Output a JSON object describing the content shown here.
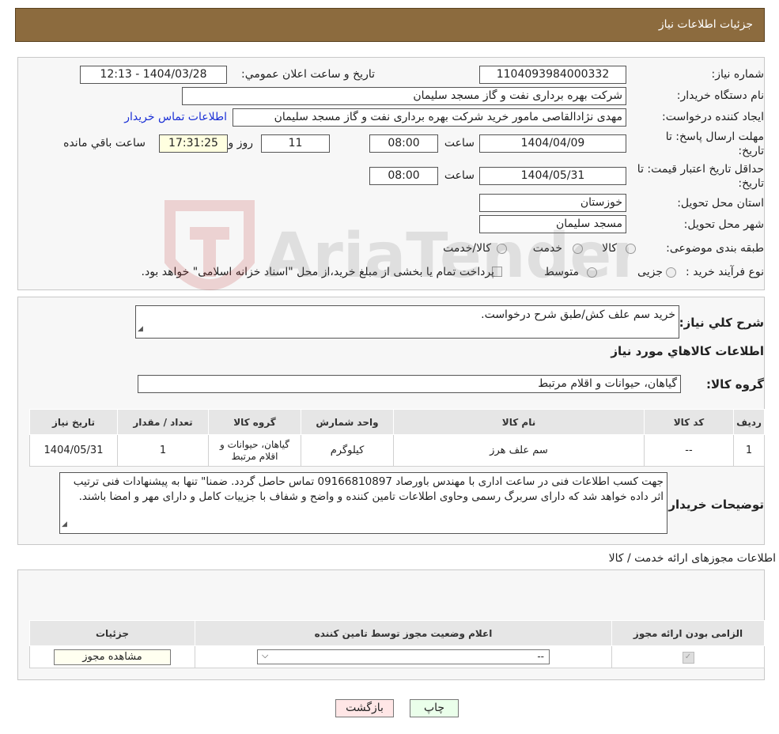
{
  "header": {
    "title": "جزئیات اطلاعات نیاز"
  },
  "fields": {
    "need_number_label": "شماره نیاز:",
    "need_number": "1104093984000332",
    "announce_label": "تاريخ و ساعت اعلان عمومي:",
    "announce_value": "1404/03/28 - 12:13",
    "buyer_org_label": "نام دستگاه خريدار:",
    "buyer_org": "شرکت بهره برداری نفت و گاز مسجد سلیمان",
    "creator_label": "ايجاد کننده درخواست:",
    "creator": "مهدی نژادالقاصی مامور خرید شرکت بهره برداری نفت و گاز مسجد سلیمان",
    "buyer_contact_link": "اطلاعات تماس خريدار",
    "reply_deadline_label_1": "مهلت ارسال پاسخ: تا",
    "reply_deadline_label_2": "تاريخ:",
    "reply_date": "1404/04/09",
    "time_label": "ساعت",
    "reply_time": "08:00",
    "days_value": "11",
    "days_label": "روز و",
    "remaining_time": "17:31:25",
    "remaining_label": "ساعت باقي مانده",
    "price_validity_label_1": "حداقل تاريخ اعتبار قيمت: تا",
    "price_validity_label_2": "تاريخ:",
    "validity_date": "1404/05/31",
    "validity_time": "08:00",
    "province_label": "استان محل تحويل:",
    "province": "خوزستان",
    "city_label": "شهر محل تحويل:",
    "city": "مسجد سلیمان",
    "category_label": "طبقه بندی موضوعی:",
    "category_options": [
      "کالا",
      "خدمت",
      "کالا/خدمت"
    ],
    "process_label": "نوع فرآيند خريد :",
    "process_options": [
      "جزیی",
      "متوسط"
    ],
    "process_note": "پرداخت تمام يا بخشی از مبلغ خريد،از محل \"اسناد خزانه اسلامی\" خواهد بود."
  },
  "summary": {
    "desc_label": "شرح كلي نياز:",
    "desc_value": "خرید سم علف کش/طبق شرح درخواست.",
    "goods_info_title": "اطلاعات كالاهاي مورد نياز",
    "goods_group_label": "گروه كالا:",
    "goods_group_value": "گیاهان، حیوانات و اقلام مرتبط"
  },
  "goods_table": {
    "headers": [
      "رديف",
      "كد كالا",
      "نام كالا",
      "واحد شمارش",
      "گروه كالا",
      "تعداد / مقدار",
      "تاريخ نياز"
    ],
    "rows": [
      [
        "1",
        "--",
        "سم علف هرز",
        "کیلوگرم",
        "گیاهان، حیوانات و اقلام مرتبط",
        "1",
        "1404/05/31"
      ]
    ]
  },
  "buyer_notes": {
    "label": "توضيحات خريدار:",
    "value": "جهت کسب اطلاعات فنی در ساعت اداری با مهندس باورصاد 09166810897 تماس حاصل گردد. ضمنا\" تنها به پیشنهادات فنی ترتیب اثر داده خواهد شد که دارای سربرگ رسمی وحاوی اطلاعات تامین کننده و واضح و شفاف با جزییات کامل و دارای مهر و امضا باشند."
  },
  "permits": {
    "title": "اطلاعات مجوزهای ارائه خدمت / کالا",
    "headers": [
      "الزامی بودن ارائه مجوز",
      "اعلام وضعیت مجوز توسط تامین کننده",
      "جزئیات"
    ],
    "select_value": "--",
    "view_button": "مشاهده مجوز"
  },
  "footer": {
    "print_button": "چاپ",
    "back_button": "بازگشت"
  },
  "watermark": {
    "text": "AriaTender.neT"
  },
  "colors": {
    "header_bg": "#8c6b3e",
    "link": "#1a2fd6",
    "print_bg": "#eaffea",
    "back_bg": "#ffe6e6"
  }
}
